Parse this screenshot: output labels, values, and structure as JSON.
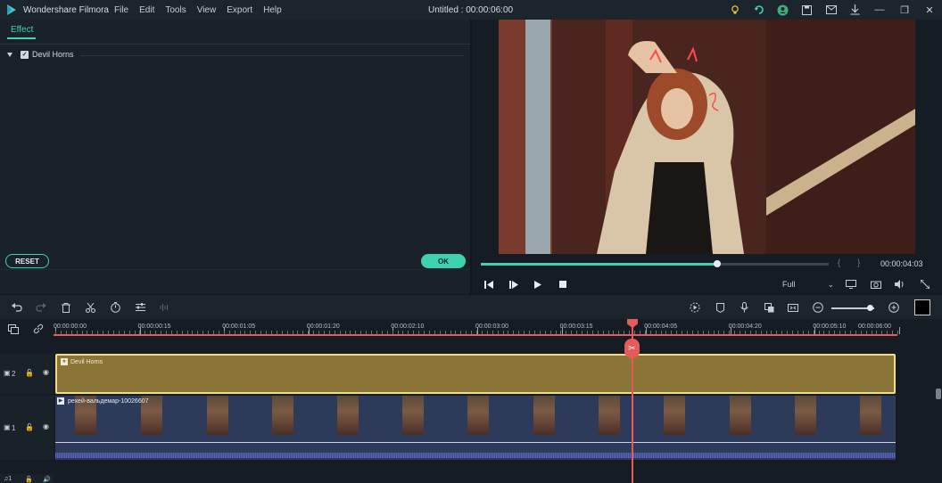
{
  "app": {
    "name": "Wondershare Filmora",
    "title": "Untitled : 00:00:06:00"
  },
  "menu": [
    "File",
    "Edit",
    "Tools",
    "View",
    "Export",
    "Help"
  ],
  "titlebar_icons": [
    "bulb-icon",
    "sync-icon",
    "account-icon",
    "save-icon",
    "mail-icon",
    "download-icon"
  ],
  "window_controls": [
    "minimize-icon",
    "maximize-icon",
    "close-icon"
  ],
  "effect_panel": {
    "tab": "Effect",
    "item": "Devil Horns",
    "item_checked": true,
    "reset_label": "RESET",
    "ok_label": "OK"
  },
  "preview": {
    "progress": 0.68,
    "timecode": "00:00:04:03",
    "quality": "Full",
    "bracket_left": "{",
    "bracket_right": "}"
  },
  "timeline": {
    "ruler_labels": [
      "00:00:00:00",
      "00:00:00:15",
      "00:00:01:05",
      "00:00:01:20",
      "00:00:02:10",
      "00:00:03:00",
      "00:00:03:15",
      "00:00:04:05",
      "00:00:04:20",
      "00:00:05:10",
      "00:00:06:00"
    ],
    "tracks": [
      {
        "number": "2",
        "clip_label": "Devil Horns"
      },
      {
        "number": "1",
        "clip_label": "рехей-вальдемар-10026607"
      }
    ],
    "zoom_level": 0.9
  },
  "colors": {
    "accent": "#3fd2b1",
    "playhead": "#e65a5a",
    "effect_clip": "#8a7436",
    "video_clip": "#2d3a5a"
  }
}
